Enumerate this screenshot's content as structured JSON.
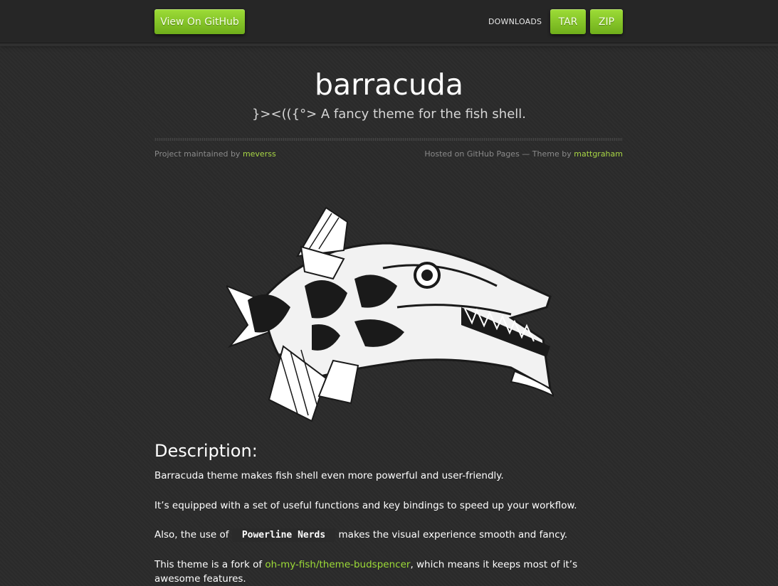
{
  "header": {
    "github_button": "View On GitHub",
    "downloads_label": "DOWNLOADS",
    "tar_button": "TAR",
    "zip_button": "ZIP"
  },
  "hero": {
    "title": "barracuda",
    "tagline": "}><(({°> A fancy theme for the fish shell."
  },
  "credits": {
    "left_prefix": "Project maintained by",
    "maintainer": "meverss",
    "right_prefix": "Hosted on GitHub Pages — Theme by",
    "theme_author": "mattgraham"
  },
  "content": {
    "heading": "Description:",
    "p1": "Barracuda theme makes fish shell even more powerful and user-friendly.",
    "p2": "It’s equipped with a set of useful functions and key bindings to speed up your workflow.",
    "p3_before": "Also, the use of",
    "p3_code": "Powerline Nerds",
    "p3_after": "makes the visual experience smooth and fancy.",
    "p4_before": "This theme is a fork of",
    "p4_link": "oh-my-fish/theme-budspencer",
    "p4_after": ", which means it keeps most of it’s awesome features."
  },
  "colors": {
    "accent": "#9ddc37",
    "link": "#a8d645",
    "background": "#2b2b2b"
  },
  "icons": {
    "fish_image": "barracuda-fish-illustration"
  }
}
